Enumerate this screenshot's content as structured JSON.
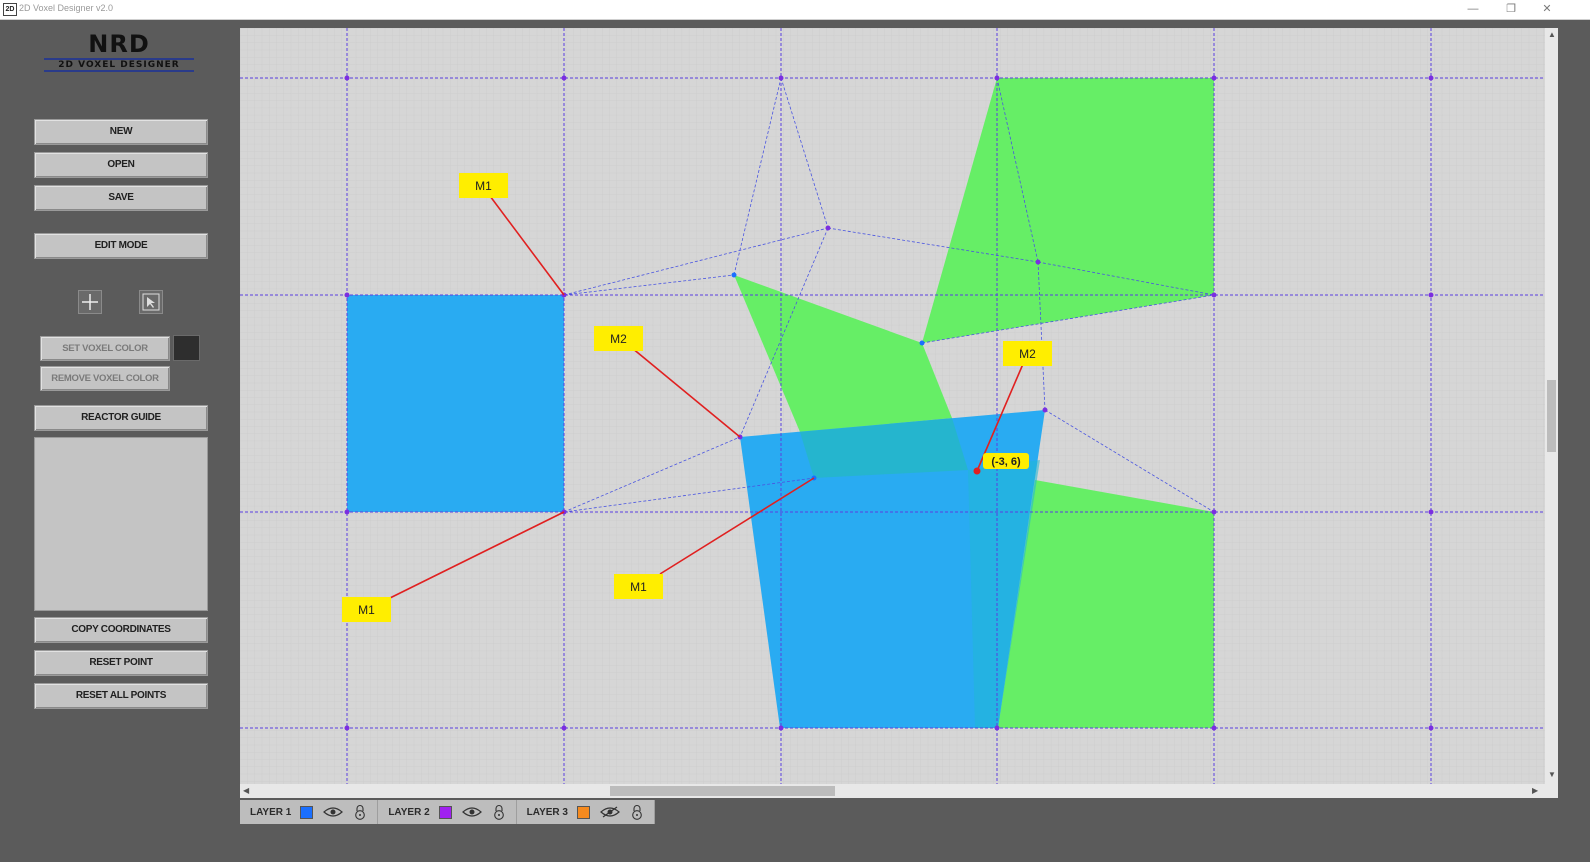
{
  "window": {
    "title": "2D Voxel Designer v2.0",
    "app_icon": "2D"
  },
  "logo": {
    "main": "NRD",
    "sub": "2D VOXEL DESIGNER"
  },
  "buttons": {
    "new": "NEW",
    "open": "OPEN",
    "save": "SAVE",
    "edit_mode": "EDIT MODE",
    "set_voxel_color": "SET VOXEL COLOR",
    "remove_voxel_color": "REMOVE VOXEL COLOR",
    "reactor_guide": "REACTOR GUIDE",
    "copy_coordinates": "COPY COORDINATES",
    "reset_point": "RESET POINT",
    "reset_all_points": "RESET ALL POINTS"
  },
  "tools": {
    "add_point_icon": "crosshair-icon",
    "select_icon": "cursor-select-icon"
  },
  "voxel_color": "#2e2e2e",
  "canvas": {
    "labels": {
      "m1": "M1",
      "m2": "M2"
    },
    "coordinate_readout": "(-3, 6)",
    "colors": {
      "blue_fill": "#29abf2",
      "green_fill": "#66ee66",
      "grid_major": "#5a3fe0",
      "marker_line": "#e02020",
      "label_bg": "#ffee00"
    }
  },
  "layers": [
    {
      "label": "LAYER 1",
      "color": "#1a6fff"
    },
    {
      "label": "LAYER 2",
      "color": "#a020f0"
    },
    {
      "label": "LAYER 3",
      "color": "#f58a1f"
    }
  ]
}
